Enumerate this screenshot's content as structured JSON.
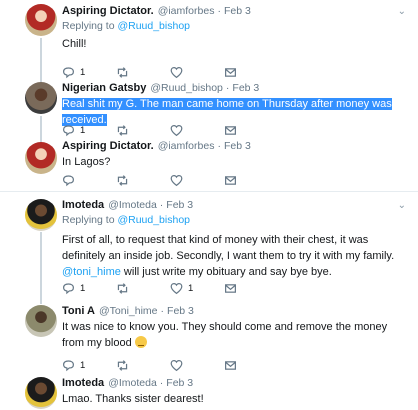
{
  "tweets": [
    {
      "name": "Aspiring Dictator.",
      "handle": "@iamforbes",
      "dot": "·",
      "time": "Feb 3",
      "replying_prefix": "Replying to ",
      "replying_to": "@Ruud_bishop",
      "text": "Chill!",
      "reply_count": "1",
      "retweet_count": "",
      "like_count": ""
    },
    {
      "name": "Nigerian Gatsby",
      "handle": "@Ruud_bishop",
      "dot": "·",
      "time": "Feb 3",
      "text": "Real shit my G. The man came home on Thursday after money was received.",
      "reply_count": "1",
      "retweet_count": "",
      "like_count": ""
    },
    {
      "name": "Aspiring Dictator.",
      "handle": "@iamforbes",
      "dot": "·",
      "time": "Feb 3",
      "text": "In Lagos?",
      "reply_count": "",
      "retweet_count": "",
      "like_count": ""
    },
    {
      "name": "Imoteda",
      "handle": "@Imoteda",
      "dot": "·",
      "time": "Feb 3",
      "replying_prefix": "Replying to ",
      "replying_to": "@Ruud_bishop",
      "text_part1": "First of all, to request that kind of money with their chest, it was definitely an inside job. Secondly, I want them to try it with my family. ",
      "mention": "@toni_hime",
      "text_part2": " will just write my obituary and say bye bye.",
      "reply_count": "1",
      "retweet_count": "",
      "like_count": "1"
    },
    {
      "name": "Toni A",
      "handle": "@Toni_hime",
      "dot": "·",
      "time": "Feb 3",
      "text": "It was nice to know you. They should come and remove the money from my blood ",
      "reply_count": "1",
      "retweet_count": "",
      "like_count": ""
    },
    {
      "name": "Imoteda",
      "handle": "@Imoteda",
      "dot": "·",
      "time": "Feb 3",
      "text": "Lmao. Thanks sister dearest!",
      "reply_count": "",
      "retweet_count": "",
      "like_count": ""
    }
  ],
  "icons": {
    "more": "chevron-down-icon",
    "reply": "reply-icon",
    "retweet": "retweet-icon",
    "like": "heart-icon",
    "dm": "envelope-icon"
  },
  "colors": {
    "link": "#1da1f2",
    "highlight": "#3390ff",
    "muted": "#657786",
    "divider": "#e6ecf0"
  }
}
